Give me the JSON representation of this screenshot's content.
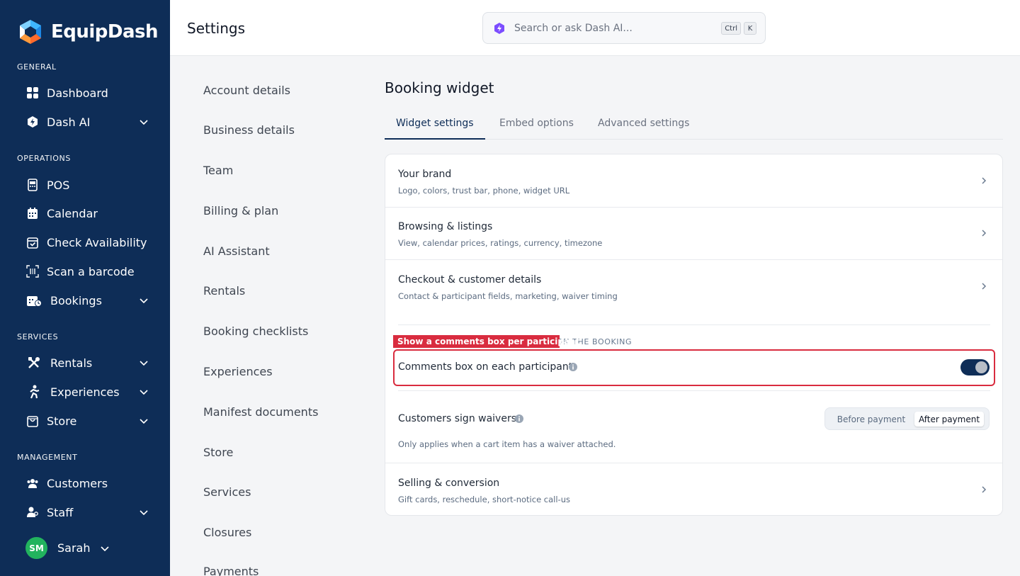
{
  "app": {
    "name": "EquipDash",
    "page_title": "Settings"
  },
  "search": {
    "placeholder": "Search or ask Dash AI...",
    "kbd1": "Ctrl",
    "kbd2": "K"
  },
  "sidebar": {
    "sections": {
      "general": "GENERAL",
      "operations": "OPERATIONS",
      "services": "SERVICES",
      "management": "MANAGEMENT"
    },
    "items": {
      "dashboard": "Dashboard",
      "dash_ai": "Dash AI",
      "pos": "POS",
      "calendar": "Calendar",
      "check_availability": "Check Availability",
      "scan_barcode": "Scan a barcode",
      "bookings": "Bookings",
      "rentals": "Rentals",
      "experiences": "Experiences",
      "store": "Store",
      "customers": "Customers",
      "staff": "Staff"
    },
    "user": {
      "initials": "SM",
      "name": "Sarah"
    }
  },
  "settings_nav": [
    "Account details",
    "Business details",
    "Team",
    "Billing & plan",
    "AI Assistant",
    "Rentals",
    "Booking checklists",
    "Experiences",
    "Manifest documents",
    "Store",
    "Services",
    "Closures",
    "Payments"
  ],
  "main": {
    "title": "Booking widget",
    "tabs": [
      "Widget settings",
      "Embed options",
      "Advanced settings"
    ],
    "active_tab": "Widget settings",
    "rows": [
      {
        "title": "Your brand",
        "subtitle": "Logo, colors, trust bar, phone, widget URL"
      },
      {
        "title": "Browsing & listings",
        "subtitle": "View, calendar prices, ratings, currency, timezone"
      },
      {
        "title": "Checkout & customer details",
        "subtitle": "Contact & participant fields, marketing, waiver timing"
      },
      {
        "title": "Selling & conversion",
        "subtitle": "Gift cards, reschedule, short-notice call-us"
      }
    ],
    "group_label_visible": "ON THE BOOKING",
    "annotation": "Show a comments box per participant",
    "comments_toggle": {
      "label": "Comments box on each participant",
      "on": true
    },
    "waivers": {
      "label": "Customers sign waivers",
      "options": [
        "Before payment",
        "After payment"
      ],
      "selected": "After payment",
      "help": "Only applies when a cart item has a waiver attached."
    }
  },
  "colors": {
    "sidebar": "#0e2d57",
    "accent": "#0e2d57",
    "annotation": "#d92c3f",
    "avatar": "#22b35e"
  }
}
